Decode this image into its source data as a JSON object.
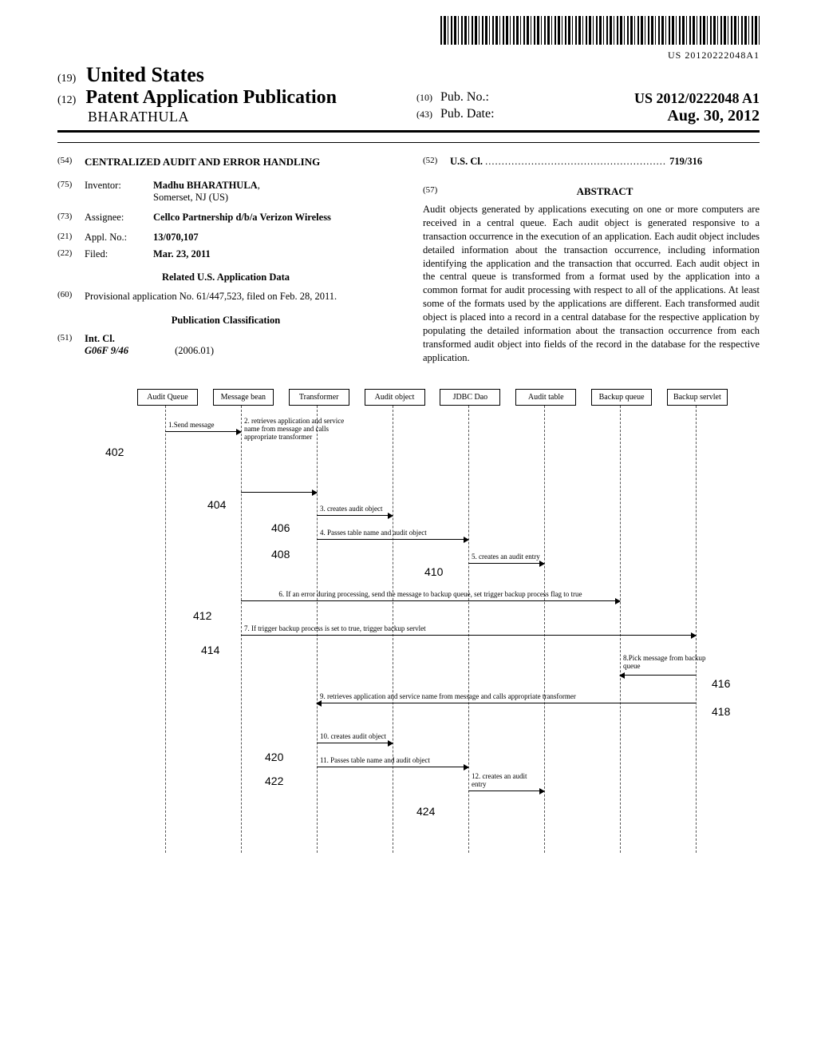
{
  "barcode_text": "US 20120222048A1",
  "header": {
    "country_code": "(19)",
    "country": "United States",
    "doc_code": "(12)",
    "doc_type": "Patent Application Publication",
    "author": "BHARATHULA",
    "pub_no_code": "(10)",
    "pub_no_label": "Pub. No.:",
    "pub_no": "US 2012/0222048 A1",
    "pub_date_code": "(43)",
    "pub_date_label": "Pub. Date:",
    "pub_date": "Aug. 30, 2012"
  },
  "left": {
    "title_code": "(54)",
    "title": "CENTRALIZED AUDIT AND ERROR HANDLING",
    "inventor_code": "(75)",
    "inventor_label": "Inventor:",
    "inventor_name": "Madhu BHARATHULA",
    "inventor_loc": "Somerset, NJ (US)",
    "assignee_code": "(73)",
    "assignee_label": "Assignee:",
    "assignee": "Cellco Partnership d/b/a Verizon Wireless",
    "appl_code": "(21)",
    "appl_label": "Appl. No.:",
    "appl_no": "13/070,107",
    "filed_code": "(22)",
    "filed_label": "Filed:",
    "filed": "Mar. 23, 2011",
    "related_head": "Related U.S. Application Data",
    "prov_code": "(60)",
    "prov_text": "Provisional application No. 61/447,523, filed on Feb. 28, 2011.",
    "class_head": "Publication Classification",
    "intcl_code": "(51)",
    "intcl_label": "Int. Cl.",
    "intcl_value": "G06F 9/46",
    "intcl_year": "(2006.01)"
  },
  "right": {
    "uscl_code": "(52)",
    "uscl_label": "U.S. Cl.",
    "uscl_value": "719/316",
    "abstract_code": "(57)",
    "abstract_head": "ABSTRACT",
    "abstract_body": "Audit objects generated by applications executing on one or more computers are received in a central queue. Each audit object is generated responsive to a transaction occurrence in the execution of an application. Each audit object includes detailed information about the transaction occurrence, including information identifying the application and the transaction that occurred. Each audit object in the central queue is transformed from a format used by the application into a common format for audit processing with respect to all of the applications. At least some of the formats used by the applications are different. Each transformed audit object is placed into a record in a central database for the respective application by populating the detailed information about the transaction occurrence from each transformed audit object into fields of the record in the database for the respective application."
  },
  "diagram": {
    "lifelines": [
      "Audit Queue",
      "Message bean",
      "Transformer",
      "Audit object",
      "JDBC Dao",
      "Audit table",
      "Backup queue",
      "Backup servlet"
    ],
    "refs": {
      "r402": "402",
      "r404": "404",
      "r406": "406",
      "r408": "408",
      "r410": "410",
      "r412": "412",
      "r414": "414",
      "r416": "416",
      "r418": "418",
      "r420": "420",
      "r422": "422",
      "r424": "424"
    },
    "msgs": {
      "m1": "1.Send message",
      "m2": "2. retrieves application and service name from message and calls appropriate transformer",
      "m3": "3. creates audit object",
      "m4": "4. Passes table name and audit object",
      "m5": "5. creates an audit entry",
      "m6": "6. If an error during processing, send the message to backup queue, set trigger backup process flag to true",
      "m7": "7. If trigger backup process is set to true, trigger backup servlet",
      "m8": "8.Pick message from backup queue",
      "m9": "9. retrieves application and service name from message and calls appropriate transformer",
      "m10": "10. creates audit object",
      "m11": "11. Passes table name and audit object",
      "m12": "12. creates an audit entry"
    }
  }
}
